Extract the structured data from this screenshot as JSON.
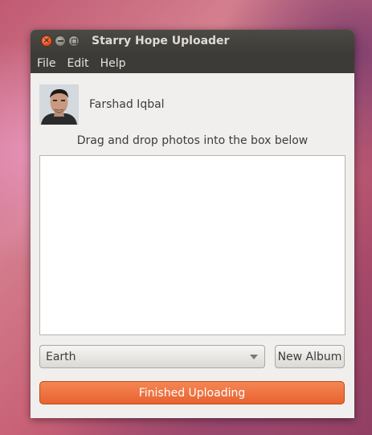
{
  "window": {
    "title": "Starry Hope Uploader"
  },
  "menu": {
    "items": [
      "File",
      "Edit",
      "Help"
    ]
  },
  "user": {
    "name": "Farshad Iqbal",
    "avatar_icon": "user-photo"
  },
  "instruction": "Drag and drop photos into the box below",
  "album": {
    "selected": "Earth",
    "new_album_label": "New Album"
  },
  "actions": {
    "finished_label": "Finished Uploading"
  },
  "colors": {
    "accent": "#e86330",
    "titlebar": "#3c3b37",
    "window_bg": "#f0efed"
  }
}
